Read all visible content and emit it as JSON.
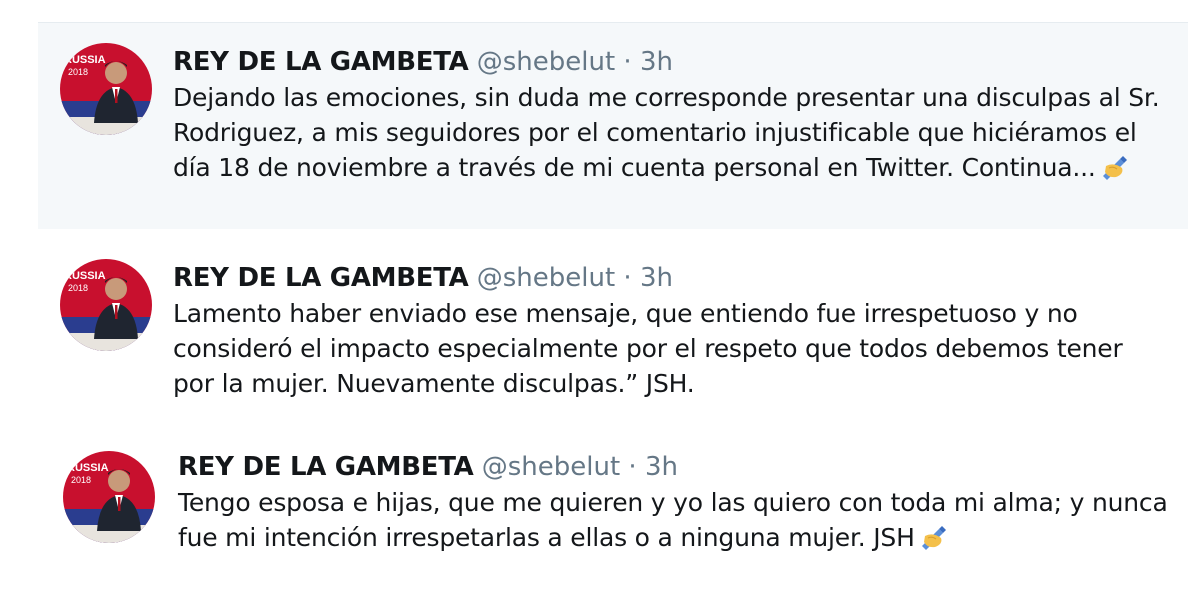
{
  "tweets": [
    {
      "display_name": "REY DE LA GAMBETA",
      "handle": "@shebelut",
      "separator": "·",
      "time": "3h",
      "text": "Dejando las emociones, sin duda me corresponde presentar una disculpas al Sr. Rodriguez, a mis seguidores por el comentario injustificable que hiciéramos el día 18 de noviembre a través de mi cuenta personal en Twitter. Continua...",
      "emoji": "writing-hand-icon"
    },
    {
      "display_name": "REY DE LA GAMBETA",
      "handle": "@shebelut",
      "separator": "·",
      "time": "3h",
      "text": "Lamento haber enviado ese mensaje, que entiendo fue irrespetuoso y no consideró el impacto especialmente por el respeto que todos debemos tener por la mujer.  Nuevamente disculpas.” JSH."
    },
    {
      "display_name": "REY DE LA GAMBETA",
      "handle": "@shebelut",
      "separator": "·",
      "time": "3h",
      "text": "Tengo esposa e hijas, que me quieren y yo las quiero con toda mi alma; y nunca fue mi intención irrespetarlas a ellas o a ninguna mujer. JSH",
      "emoji": "writing-hand-icon"
    }
  ],
  "avatar_text": [
    "RUSSIA",
    "2018"
  ],
  "colors": {
    "name": "#14171a",
    "secondary": "#657786",
    "highlight_bg": "#f5f8fa",
    "avatar_red": "#c8102e"
  }
}
